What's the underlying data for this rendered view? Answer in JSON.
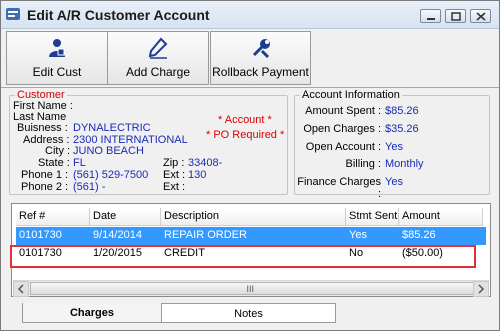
{
  "window": {
    "title": "Edit A/R Customer Account"
  },
  "toolbar": {
    "buttons": [
      {
        "label": "Edit Cust",
        "icon": "person-icon"
      },
      {
        "label": "Add Charge",
        "icon": "pencil-icon"
      },
      {
        "label": "Rollback Payment",
        "icon": "wrench-icon"
      }
    ]
  },
  "customer": {
    "legend": "Customer",
    "labels": {
      "first_name": "First Name :",
      "last_name": "Last Name",
      "business": "Buisness :",
      "address": "Address :",
      "city": "City :",
      "state": "State :",
      "phone1": "Phone 1 :",
      "phone2": "Phone 2 :",
      "zip": "Zip :",
      "ext1": "Ext :",
      "ext2": "Ext :"
    },
    "values": {
      "business": "DYNALECTRIC",
      "address": "2300 INTERNATIONAL",
      "city": "JUNO BEACH",
      "state": "FL",
      "phone1": "(561) 529-7500",
      "phone2": "(561)    -",
      "zip": "33408-",
      "ext1": "130"
    },
    "required_account": "* Account *",
    "required_po": "* PO Required *"
  },
  "account_info": {
    "legend": "Account Information",
    "labels": {
      "amount_spent": "Amount Spent :",
      "open_charges": "Open Charges :",
      "open_account": "Open Account :",
      "billing": "Billing :",
      "finance_charges": "Finance Charges :"
    },
    "values": {
      "amount_spent": "$85.26",
      "open_charges": "$35.26",
      "open_account": "Yes",
      "billing": "Monthly",
      "finance_charges": "Yes"
    }
  },
  "grid": {
    "columns": [
      "Ref #",
      "Date",
      "Description",
      "Stmt Sent",
      "Amount"
    ],
    "rows": [
      {
        "ref": "0101730",
        "date": "9/14/2014",
        "description": "REPAIR ORDER",
        "stmt_sent": "Yes",
        "amount": "$85.26",
        "selected": true
      },
      {
        "ref": "0101730",
        "date": "1/20/2015",
        "description": "CREDIT",
        "stmt_sent": "No",
        "amount": "($50.00)",
        "selected": false
      }
    ],
    "scroll_grip": "III"
  },
  "tabs": [
    {
      "label": "Charges",
      "active": true
    },
    {
      "label": "Notes",
      "active": false
    }
  ],
  "colors": {
    "selection": "#3399ff",
    "value_blue": "#1a2bb8",
    "required_red": "#e00000",
    "highlight_red": "#e0303a"
  }
}
